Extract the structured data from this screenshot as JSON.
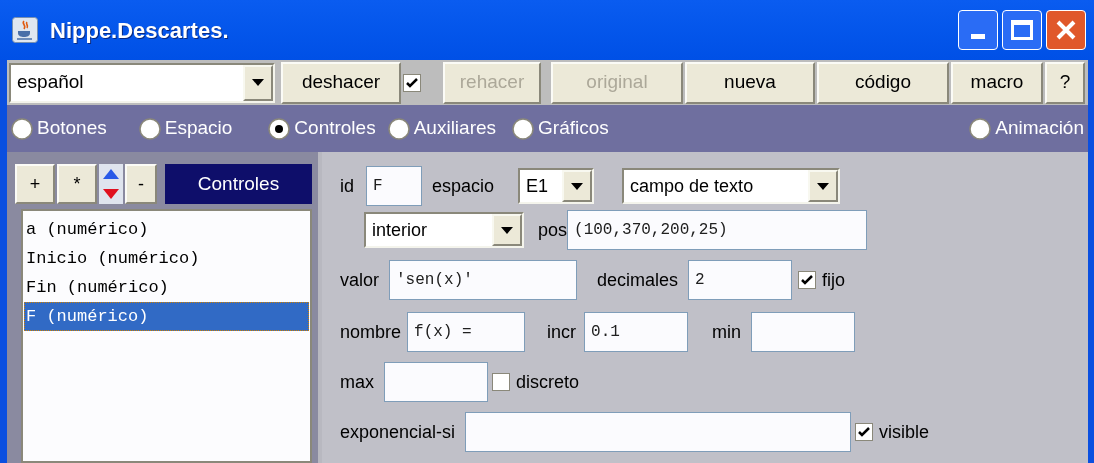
{
  "window": {
    "title": "Nippe.Descartes."
  },
  "toolbar": {
    "language": "español",
    "items": [
      {
        "kind": "button",
        "label": "deshacer",
        "disabled": false
      },
      {
        "kind": "checkbox",
        "checked": true
      },
      {
        "kind": "button",
        "label": "rehacer",
        "disabled": true
      },
      {
        "kind": "button",
        "label": "original",
        "disabled": true
      },
      {
        "kind": "button",
        "label": "nueva",
        "disabled": false
      },
      {
        "kind": "button",
        "label": "código",
        "disabled": false
      },
      {
        "kind": "button",
        "label": "macro",
        "disabled": false
      },
      {
        "kind": "button",
        "label": "?",
        "disabled": false
      }
    ]
  },
  "sections": [
    {
      "label": "Botones",
      "selected": false
    },
    {
      "label": "Espacio",
      "selected": false
    },
    {
      "label": "Controles",
      "selected": true
    },
    {
      "label": "Auxiliares",
      "selected": false
    },
    {
      "label": "Gráficos",
      "selected": false
    },
    {
      "label": "Animación",
      "selected": false
    }
  ],
  "list_panel": {
    "buttons": [
      "+",
      "*",
      "-"
    ],
    "title": "Controles",
    "items": [
      {
        "label": "a (numérico)",
        "selected": false
      },
      {
        "label": "Inicio (numérico)",
        "selected": false
      },
      {
        "label": "Fin (numérico)",
        "selected": false
      },
      {
        "label": "F (numérico)",
        "selected": true
      }
    ]
  },
  "form": [
    [
      {
        "kind": "label",
        "text": "id"
      },
      {
        "kind": "text",
        "value": "F"
      },
      {
        "kind": "label",
        "text": "espacio"
      },
      {
        "kind": "select",
        "value": "E1"
      },
      {
        "kind": "select",
        "value": "campo de texto"
      }
    ],
    [
      {
        "kind": "select",
        "value": "interior"
      },
      {
        "kind": "label",
        "text": "pos"
      },
      {
        "kind": "text",
        "value": "(100,370,200,25)"
      }
    ],
    [
      {
        "kind": "label",
        "text": "valor"
      },
      {
        "kind": "text",
        "value": "'sen(x)'"
      },
      {
        "kind": "label",
        "text": "decimales"
      },
      {
        "kind": "text",
        "value": "2"
      },
      {
        "kind": "checkbox",
        "text": "fijo",
        "checked": true
      }
    ],
    [
      {
        "kind": "label",
        "text": "nombre"
      },
      {
        "kind": "text",
        "value": "f(x) ="
      },
      {
        "kind": "label",
        "text": "incr"
      },
      {
        "kind": "text",
        "value": "0.1"
      },
      {
        "kind": "label",
        "text": "min"
      },
      {
        "kind": "text"
      }
    ],
    [
      {
        "kind": "label",
        "text": "max"
      },
      {
        "kind": "text"
      },
      {
        "kind": "checkbox",
        "text": "discreto",
        "checked": false
      }
    ],
    [
      {
        "kind": "label",
        "text": "exponencial-si"
      },
      {
        "kind": "text"
      },
      {
        "kind": "checkbox",
        "text": "visible",
        "checked": true
      }
    ]
  ]
}
